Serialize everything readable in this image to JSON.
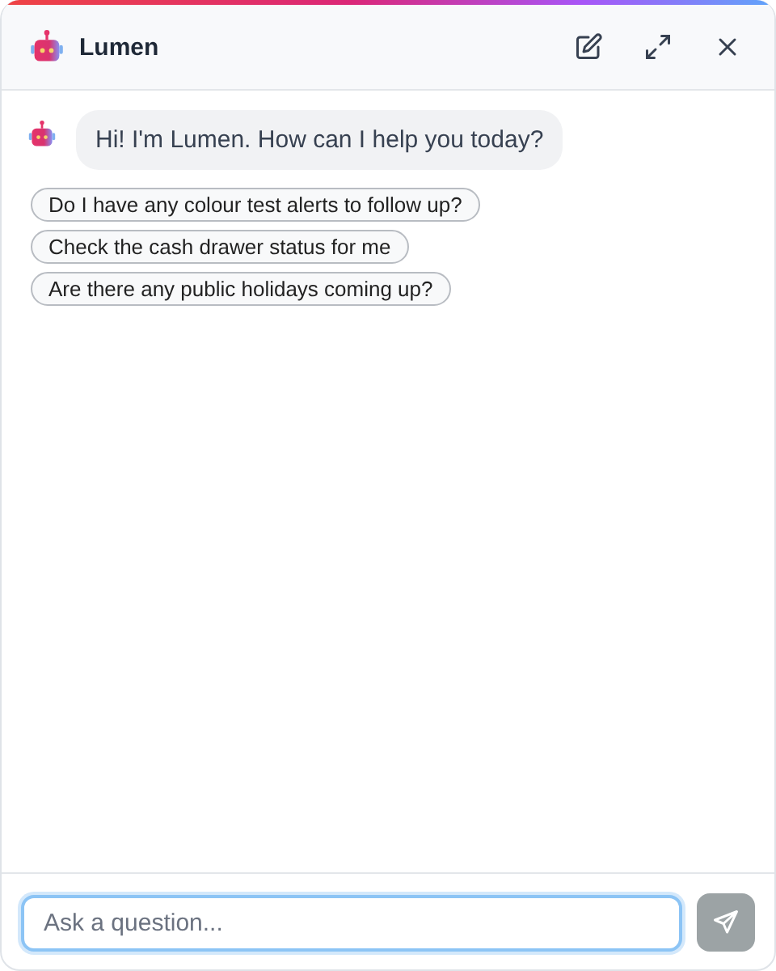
{
  "header": {
    "title": "Lumen"
  },
  "messages": [
    {
      "kind": "bot",
      "text": "Hi! I'm Lumen. How can I help you today?"
    }
  ],
  "suggestions": [
    "Do I have any colour test alerts to follow up?",
    "Check the cash drawer status for me",
    "Are there any public holidays coming up?"
  ],
  "composer": {
    "placeholder": "Ask a question...",
    "send_disabled": true
  }
}
